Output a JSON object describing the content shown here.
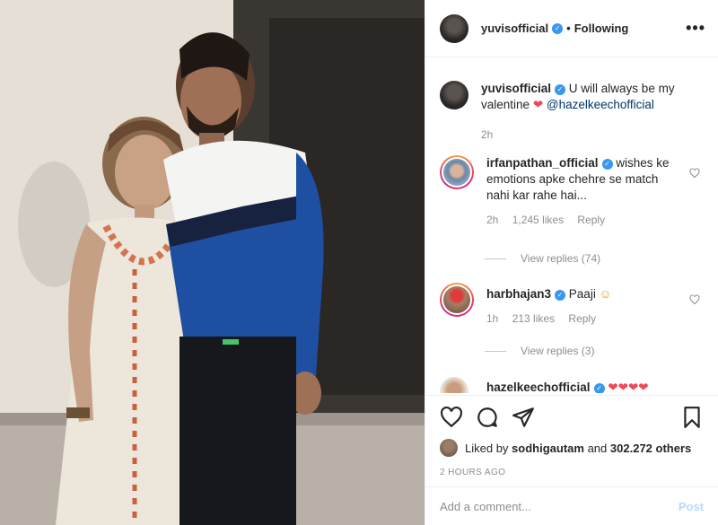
{
  "post": {
    "author": "yuvisofficial",
    "follow_status": "Following",
    "more_label": "•••",
    "dot": "•"
  },
  "caption": {
    "author": "yuvisofficial",
    "text": "U will always be my valentine",
    "heart": "❤",
    "mention": "@hazelkeechofficial",
    "time": "2h"
  },
  "comments": [
    {
      "author": "irfanpathan_official",
      "text": "wishes ke emotions apke chehre se match nahi kar rahe hai...",
      "time": "2h",
      "likes": "1,245 likes",
      "reply": "Reply",
      "view_replies": "View replies (74)"
    },
    {
      "author": "harbhajan3",
      "text": "Paaji",
      "emoji": "☺",
      "time": "1h",
      "likes": "213 likes",
      "reply": "Reply",
      "view_replies": "View replies (3)"
    },
    {
      "author": "hazelkeechofficial",
      "text": "❤❤❤❤"
    }
  ],
  "liked_by": {
    "prefix": "Liked by",
    "user": "sodhigautam",
    "joiner": "and",
    "others": "302.272 others"
  },
  "time_ago": "2 HOURS AGO",
  "add_comment": {
    "placeholder": "Add a comment...",
    "post_label": "Post"
  },
  "colors": {
    "verified": "#3897f0",
    "heart": "#ed4956",
    "mention": "#00376b",
    "muted": "#8e8e8e"
  }
}
